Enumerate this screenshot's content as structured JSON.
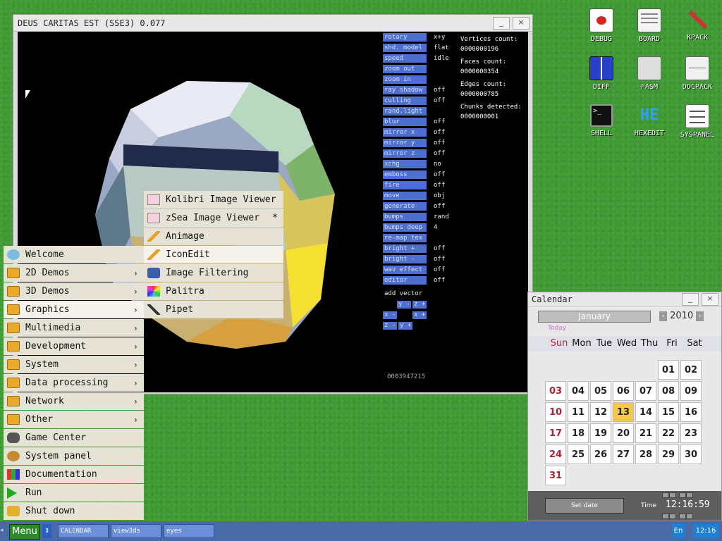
{
  "desktop": {
    "icons": [
      {
        "label": "DEBUG"
      },
      {
        "label": "BOARD"
      },
      {
        "label": "KPACK"
      },
      {
        "label": "DIFF"
      },
      {
        "label": "FASM"
      },
      {
        "label": "DOCPACK"
      },
      {
        "label": "SHELL"
      },
      {
        "label": "HEXEDIT"
      },
      {
        "label": "SYSPANEL"
      }
    ],
    "hexedit_logo": "HE"
  },
  "view3d": {
    "title": "DEUS CARITAS EST (SSE3) 0.077",
    "min_label": "_",
    "close_label": "×",
    "params": [
      {
        "label": "rotary",
        "value": "x+y"
      },
      {
        "label": "shd. model",
        "value": "flat"
      },
      {
        "label": "speed",
        "value": "idle"
      },
      {
        "label": "zoom out",
        "value": ""
      },
      {
        "label": "zoom in",
        "value": ""
      },
      {
        "label": "ray shadow",
        "value": "off"
      },
      {
        "label": "culling",
        "value": "off"
      },
      {
        "label": "rand.light",
        "value": ""
      },
      {
        "label": "blur",
        "value": "off"
      },
      {
        "label": "mirror x",
        "value": "off"
      },
      {
        "label": "mirror y",
        "value": "off"
      },
      {
        "label": "mirror z",
        "value": "off"
      },
      {
        "label": "xchg",
        "value": "no"
      },
      {
        "label": "emboss",
        "value": "off"
      },
      {
        "label": "fire",
        "value": "off"
      },
      {
        "label": "move",
        "value": "obj"
      },
      {
        "label": "generate",
        "value": "off"
      },
      {
        "label": "bumps",
        "value": "rand"
      },
      {
        "label": "bumps deep",
        "value": "4"
      },
      {
        "label": "re-map tex",
        "value": ""
      },
      {
        "label": "bright +",
        "value": "off"
      },
      {
        "label": "bright -",
        "value": "off"
      },
      {
        "label": "wav effect",
        "value": "off"
      },
      {
        "label": "editor",
        "value": "off"
      }
    ],
    "stats": {
      "vertices_label": "Vertices count:",
      "vertices": "0000000196",
      "faces_label": "Faces count:",
      "faces": "0000000354",
      "edges_label": "Edges count:",
      "edges": "0000000785",
      "chunks_label": "Chunks detected:",
      "chunks": "0000000001"
    },
    "add_vector_label": "add vector",
    "vector_buttons": [
      "y -",
      "z +",
      "x -",
      "x +",
      "z -",
      "y +"
    ],
    "counter": "0003947215"
  },
  "start_menu": {
    "items": [
      {
        "label": "Welcome",
        "arrow": ""
      },
      {
        "label": "2D Demos",
        "arrow": "›"
      },
      {
        "label": "3D Demos",
        "arrow": "›"
      },
      {
        "label": "Graphics",
        "arrow": "›"
      },
      {
        "label": "Multimedia",
        "arrow": "›"
      },
      {
        "label": "Development",
        "arrow": "›"
      },
      {
        "label": "System",
        "arrow": "›"
      },
      {
        "label": "Data processing",
        "arrow": "›"
      },
      {
        "label": "Network",
        "arrow": "›"
      },
      {
        "label": "Other",
        "arrow": "›"
      },
      {
        "label": "Game Center",
        "arrow": ""
      },
      {
        "label": "System panel",
        "arrow": ""
      },
      {
        "label": "Documentation",
        "arrow": ""
      },
      {
        "label": "Run",
        "arrow": ""
      },
      {
        "label": "Shut down",
        "arrow": ""
      }
    ]
  },
  "graphics_submenu": {
    "items": [
      {
        "label": "Kolibri Image Viewer",
        "mark": ""
      },
      {
        "label": "zSea Image Viewer",
        "mark": "*"
      },
      {
        "label": "Animage",
        "mark": ""
      },
      {
        "label": "IconEdit",
        "mark": ""
      },
      {
        "label": "Image Filtering",
        "mark": ""
      },
      {
        "label": "Palitra",
        "mark": ""
      },
      {
        "label": "Pipet",
        "mark": ""
      }
    ]
  },
  "calendar": {
    "title": "Calendar",
    "min_label": "_",
    "close_label": "×",
    "month": "January",
    "year": "2010",
    "prev": "‹",
    "next": "›",
    "today_label": "Today",
    "days_of_week": [
      "Sun",
      "Mon",
      "Tue",
      "Wed",
      "Thu",
      "Fri",
      "Sat"
    ],
    "dates": [
      "01",
      "02",
      "03",
      "04",
      "05",
      "06",
      "07",
      "08",
      "09",
      "10",
      "11",
      "12",
      "13",
      "14",
      "15",
      "16",
      "17",
      "18",
      "19",
      "20",
      "21",
      "22",
      "23",
      "24",
      "25",
      "26",
      "27",
      "28",
      "29",
      "30",
      "31"
    ],
    "selected": "13",
    "set_date_label": "Set date",
    "time_label": "Time",
    "time": "12:16:59"
  },
  "taskbar": {
    "menu_label": "Menu",
    "arrows": "⇕",
    "tasks": [
      "CALENDAR",
      "view3ds",
      "eyes"
    ],
    "lang": "En",
    "clock": "12:16",
    "left_arrow": "◂"
  },
  "colors": {
    "desktop_green": "#3f9a33",
    "taskbar_blue": "#4a6aa5",
    "param_blue": "#4f6fd0",
    "menu_item_bg": "#e6e3d6",
    "calendar_selected": "#f5c84a"
  }
}
